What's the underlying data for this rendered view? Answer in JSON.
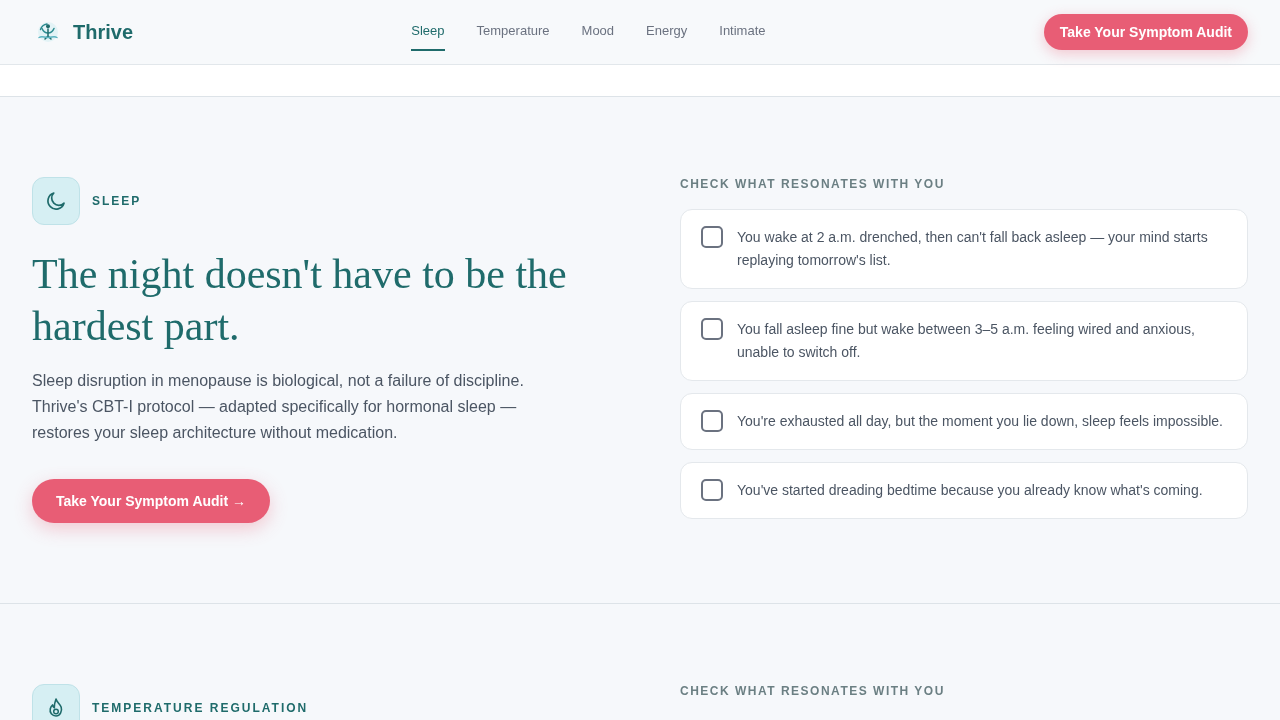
{
  "header": {
    "brand": "Thrive",
    "nav": [
      {
        "label": "Sleep",
        "selected": true
      },
      {
        "label": "Temperature",
        "selected": false
      },
      {
        "label": "Mood",
        "selected": false
      },
      {
        "label": "Energy",
        "selected": false
      },
      {
        "label": "Intimate",
        "selected": false
      }
    ],
    "cta": "Take Your Symptom Audit"
  },
  "sections": [
    {
      "kind": "sleep",
      "eyebrow": "SLEEP",
      "headline": "The night doesn't have to be the hardest part.",
      "body": "Sleep disruption in menopause is biological, not a failure of discipline. Thrive's CBT-I protocol — adapted specifically for hormonal sleep — restores your sleep architecture without medication.",
      "cta": "Take Your Symptom Audit →",
      "checklist": {
        "title": "CHECK WHAT RESONATES WITH YOU",
        "items": [
          {
            "text": "You wake at 2 a.m. drenched, then can't fall back asleep — your mind starts replaying tomorrow's list.",
            "checked": false
          },
          {
            "text": "You fall asleep fine but wake between 3–5 a.m. feeling wired and anxious, unable to switch off.",
            "checked": false
          },
          {
            "text": "You're exhausted all day, but the moment you lie down, sleep feels impossible.",
            "checked": false
          },
          {
            "text": "You've started dreading bedtime because you already know what's coming.",
            "checked": false
          }
        ]
      }
    },
    {
      "kind": "temperature",
      "eyebrow": "TEMPERATURE REGULATION",
      "checklist": {
        "title": "CHECK WHAT RESONATES WITH YOU"
      }
    }
  ]
}
